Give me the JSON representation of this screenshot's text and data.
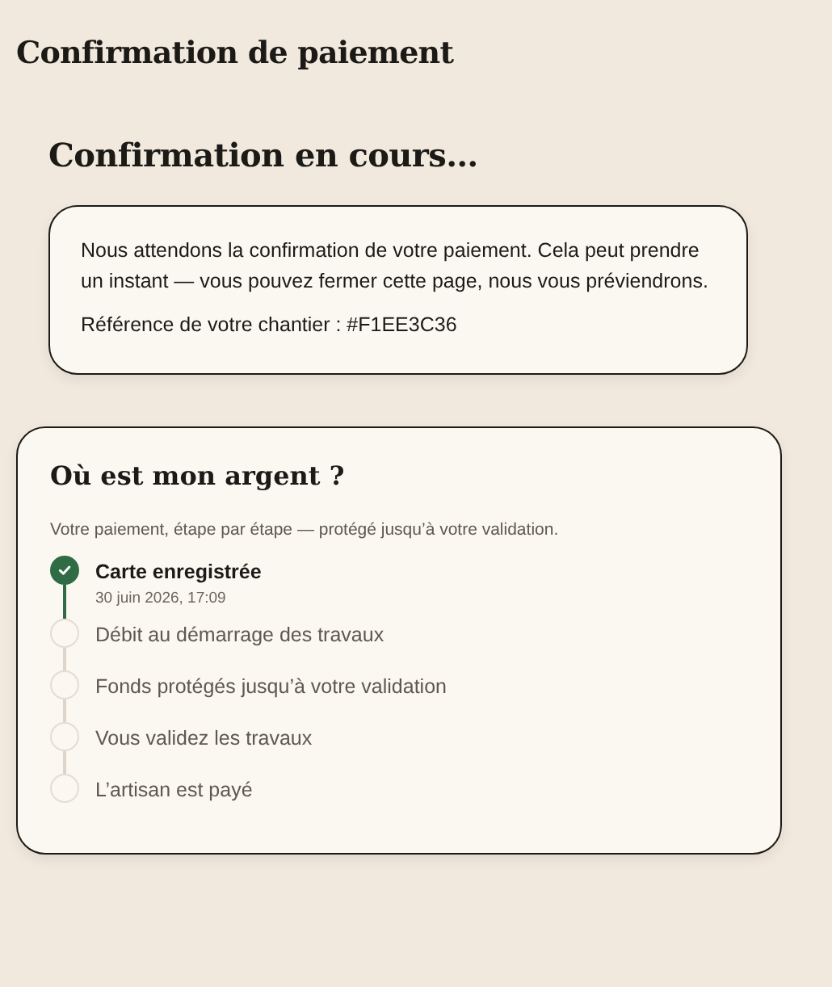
{
  "page_title": "Confirmation de paiement",
  "status": {
    "heading": "Confirmation en cours…",
    "message": "Nous attendons la confirmation de votre paiement. Cela peut prendre un instant — vous pouvez fermer cette page, nous vous préviendrons.",
    "reference": "Référence de votre chantier : #F1EE3C36"
  },
  "tracker": {
    "heading": "Où est mon argent ?",
    "subtitle": "Votre paiement, étape par étape — protégé jusqu’à votre validation.",
    "steps": [
      {
        "label": "Carte enregistrée",
        "date": "30 juin 2026, 17:09",
        "done": true
      },
      {
        "label": "Débit au démarrage des travaux",
        "done": false
      },
      {
        "label": "Fonds protégés jusqu’à votre validation",
        "done": false
      },
      {
        "label": "Vous validez les travaux",
        "done": false
      },
      {
        "label": "L’artisan est payé",
        "done": false
      }
    ]
  }
}
